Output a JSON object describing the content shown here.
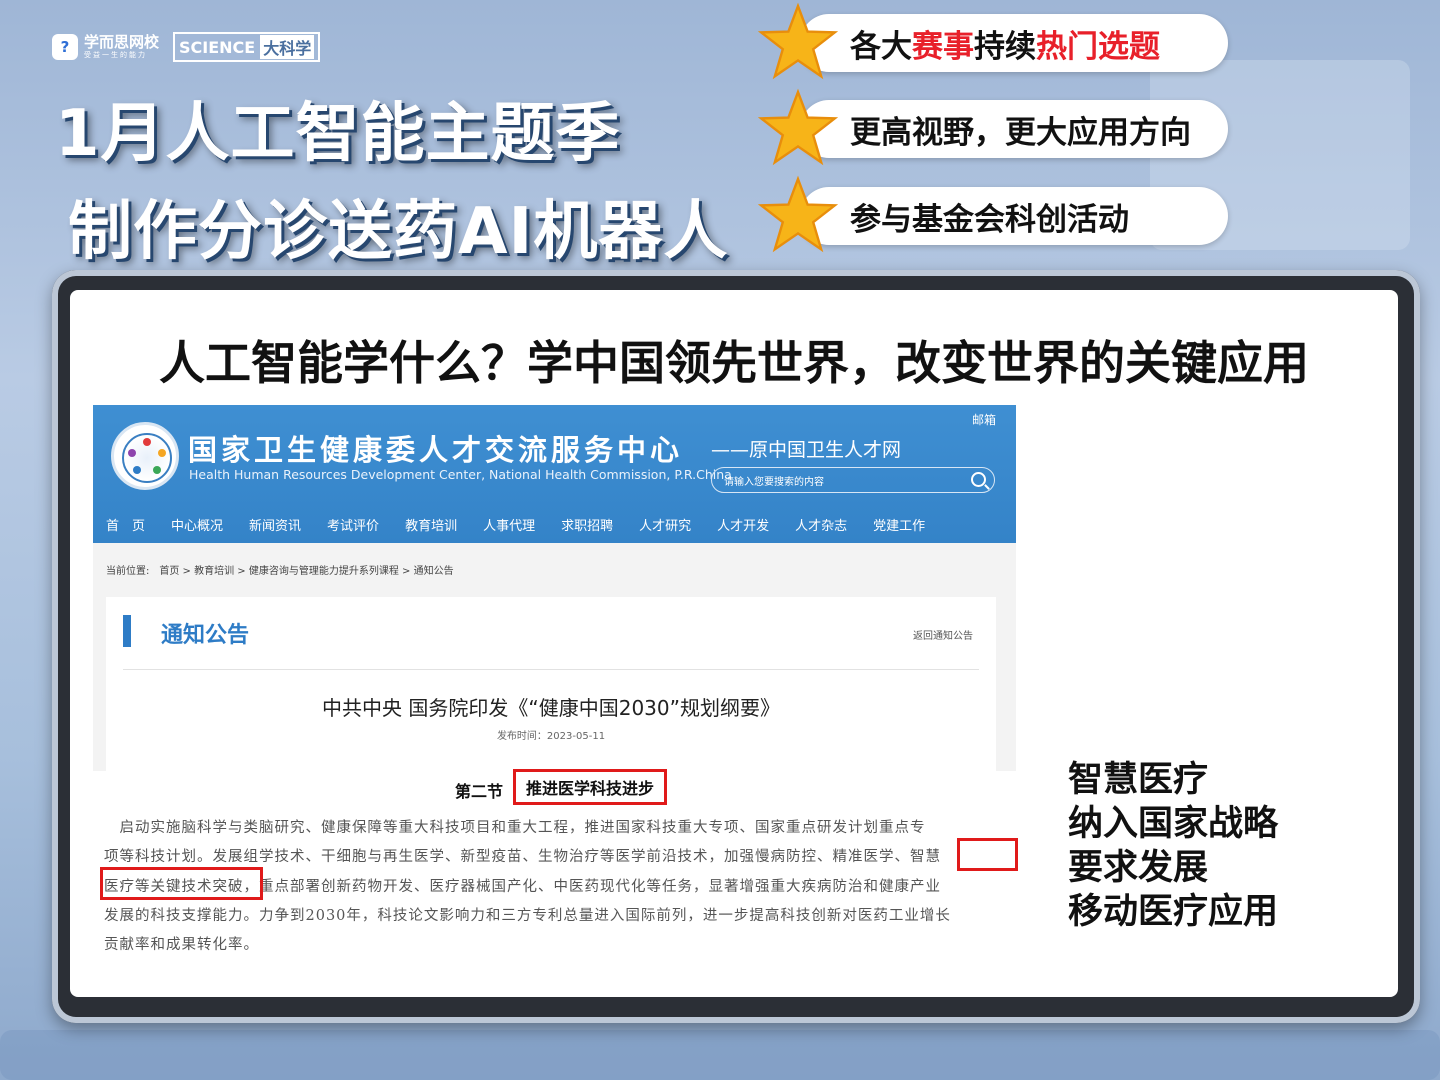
{
  "logos": {
    "brand_mark": "?",
    "brand_name": "学而思网校",
    "brand_slogan": "受益一生的能力",
    "science_text": "SCIENCE",
    "science_cn": "大科学"
  },
  "title": {
    "line1": "1月人工智能主题季",
    "line2": "制作分诊送药AI机器人"
  },
  "features": [
    {
      "parts": [
        "各大",
        "赛事",
        "持续",
        "热门选题"
      ],
      "red": [
        false,
        true,
        false,
        true
      ]
    },
    {
      "parts": [
        "更高视野，更大应用方向"
      ],
      "red": [
        false
      ]
    },
    {
      "parts": [
        "参与基金会科创活动"
      ],
      "red": [
        false
      ]
    }
  ],
  "headline": "人工智能学什么？学中国领先世界，改变世界的关键应用",
  "website": {
    "org_cn": "国家卫生健康委人才交流服务中心",
    "org_en": "Health Human Resources Development Center, National Health Commission, P.R.China",
    "org_sub": "——原中国卫生人才网",
    "mail": "邮箱",
    "search_placeholder": "请输入您要搜索的内容",
    "nav": [
      "首　页",
      "中心概况",
      "新闻资讯",
      "考试评价",
      "教育培训",
      "人事代理",
      "求职招聘",
      "人才研究",
      "人才开发",
      "人才杂志",
      "党建工作"
    ],
    "breadcrumb": "当前位置:　首页 > 教育培训 > 健康咨询与管理能力提升系列课程 > 通知公告",
    "section_title": "通知公告",
    "back_link": "返回通知公告",
    "article_title": "中共中央 国务院印发《“健康中国2030”规划纲要》",
    "publish_date": "发布时间：2023-05-11"
  },
  "excerpt": {
    "section_no": "第二节",
    "section_title": "推进医学科技进步",
    "lines": [
      "　启动实施脑科学与类脑研究、健康保障等重大科技项目和重大工程，推进国家科技重大专项、国家重点研发计划重点专",
      "项等科技计划。发展组学技术、干细胞与再生医学、新型疫苗、生物治疗等医学前沿技术，加强慢病防控、精准医学、智慧",
      "医疗等关键技术突破，重点部署创新药物开发、医疗器械国产化、中医药现代化等任务，显著增强重大疾病防治和健康产业",
      "发展的科技支撑能力。力争到2030年，科技论文影响力和三方专利总量进入国际前列，进一步提高科技创新对医药工业增长",
      "贡献率和成果转化率。"
    ]
  },
  "side_notes": [
    "智慧医疗",
    "纳入国家战略",
    "要求发展",
    "移动医疗应用"
  ],
  "colors": {
    "accent_red": "#e8202a",
    "site_blue": "#3483c8",
    "star_gold": "#f7b418"
  }
}
